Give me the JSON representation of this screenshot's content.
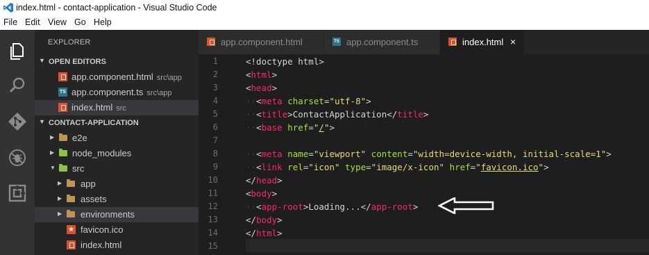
{
  "window": {
    "title": "index.html - contact-application - Visual Studio Code"
  },
  "menu": [
    "File",
    "Edit",
    "View",
    "Go",
    "Help"
  ],
  "sidebar": {
    "title": "EXPLORER",
    "open_editors": {
      "header": "OPEN EDITORS",
      "items": [
        {
          "label": "app.component.html",
          "hint": "src\\app"
        },
        {
          "label": "app.component.ts",
          "hint": "src\\app"
        },
        {
          "label": "index.html",
          "hint": "src"
        }
      ]
    },
    "project": {
      "header": "CONTACT-APPLICATION",
      "items": [
        {
          "label": "e2e"
        },
        {
          "label": "node_modules"
        },
        {
          "label": "src"
        },
        {
          "label": "app"
        },
        {
          "label": "assets"
        },
        {
          "label": "environments"
        },
        {
          "label": "favicon.ico"
        },
        {
          "label": "index.html"
        }
      ]
    }
  },
  "tabs": [
    {
      "label": "app.component.html"
    },
    {
      "label": "app.component.ts"
    },
    {
      "label": "index.html",
      "close": "×"
    }
  ],
  "editor": {
    "line_numbers": [
      "1",
      "2",
      "3",
      "4",
      "5",
      "6",
      "7",
      "8",
      "9",
      "10",
      "11",
      "12",
      "13",
      "14",
      "15"
    ],
    "lines": [
      [
        [
          "t",
          "<!doctype html>"
        ]
      ],
      [
        [
          "t",
          "<"
        ],
        [
          "k",
          "html"
        ],
        [
          "t",
          ">"
        ]
      ],
      [
        [
          "t",
          "<"
        ],
        [
          "k",
          "head"
        ],
        [
          "t",
          ">"
        ]
      ],
      [
        [
          "d",
          "··"
        ],
        [
          "t",
          "<"
        ],
        [
          "k",
          "meta"
        ],
        [
          "t",
          " "
        ],
        [
          "a",
          "charset"
        ],
        [
          "t",
          "="
        ],
        [
          "s",
          "\"utf-8\""
        ],
        [
          "t",
          ">"
        ]
      ],
      [
        [
          "d",
          "··"
        ],
        [
          "t",
          "<"
        ],
        [
          "k",
          "title"
        ],
        [
          "t",
          ">ContactApplication</"
        ],
        [
          "k",
          "title"
        ],
        [
          "t",
          ">"
        ]
      ],
      [
        [
          "d",
          "··"
        ],
        [
          "t",
          "<"
        ],
        [
          "k",
          "base"
        ],
        [
          "t",
          " "
        ],
        [
          "a",
          "href"
        ],
        [
          "t",
          "="
        ],
        [
          "s",
          "\""
        ],
        [
          "u",
          "/"
        ],
        [
          "s",
          "\""
        ],
        [
          "t",
          ">"
        ]
      ],
      [],
      [
        [
          "d",
          "··"
        ],
        [
          "t",
          "<"
        ],
        [
          "k",
          "meta"
        ],
        [
          "t",
          " "
        ],
        [
          "a",
          "name"
        ],
        [
          "t",
          "="
        ],
        [
          "s",
          "\"viewport\""
        ],
        [
          "t",
          " "
        ],
        [
          "a",
          "content"
        ],
        [
          "t",
          "="
        ],
        [
          "s",
          "\"width=device-width, initial-scale=1\""
        ],
        [
          "t",
          ">"
        ]
      ],
      [
        [
          "d",
          "··"
        ],
        [
          "t",
          "<"
        ],
        [
          "k",
          "link"
        ],
        [
          "t",
          " "
        ],
        [
          "a",
          "rel"
        ],
        [
          "t",
          "="
        ],
        [
          "s",
          "\"icon\""
        ],
        [
          "t",
          " "
        ],
        [
          "a",
          "type"
        ],
        [
          "t",
          "="
        ],
        [
          "s",
          "\"image/x-icon\""
        ],
        [
          "t",
          " "
        ],
        [
          "a",
          "href"
        ],
        [
          "t",
          "="
        ],
        [
          "s",
          "\""
        ],
        [
          "u",
          "favicon.ico"
        ],
        [
          "s",
          "\""
        ],
        [
          "t",
          ">"
        ]
      ],
      [
        [
          "t",
          "</"
        ],
        [
          "k",
          "head"
        ],
        [
          "t",
          ">"
        ]
      ],
      [
        [
          "t",
          "<"
        ],
        [
          "k",
          "body"
        ],
        [
          "t",
          ">"
        ]
      ],
      [
        [
          "d",
          "··"
        ],
        [
          "t",
          "<"
        ],
        [
          "k",
          "app-root"
        ],
        [
          "t",
          ">Loading...</"
        ],
        [
          "k",
          "app-root"
        ],
        [
          "t",
          ">"
        ]
      ],
      [
        [
          "t",
          "</"
        ],
        [
          "k",
          "body"
        ],
        [
          "t",
          ">"
        ]
      ],
      [
        [
          "t",
          "</"
        ],
        [
          "k",
          "html"
        ],
        [
          "t",
          ">"
        ]
      ],
      []
    ]
  },
  "colors": {
    "tag": "#f92672",
    "attr": "#a6e22e",
    "string": "#e6db74",
    "text": "#d4d4d4",
    "whitespace_dots": "#4b4b4b",
    "html_icon": "#e44d26",
    "ts_icon": "#2b7489",
    "folder": "#c09553"
  }
}
